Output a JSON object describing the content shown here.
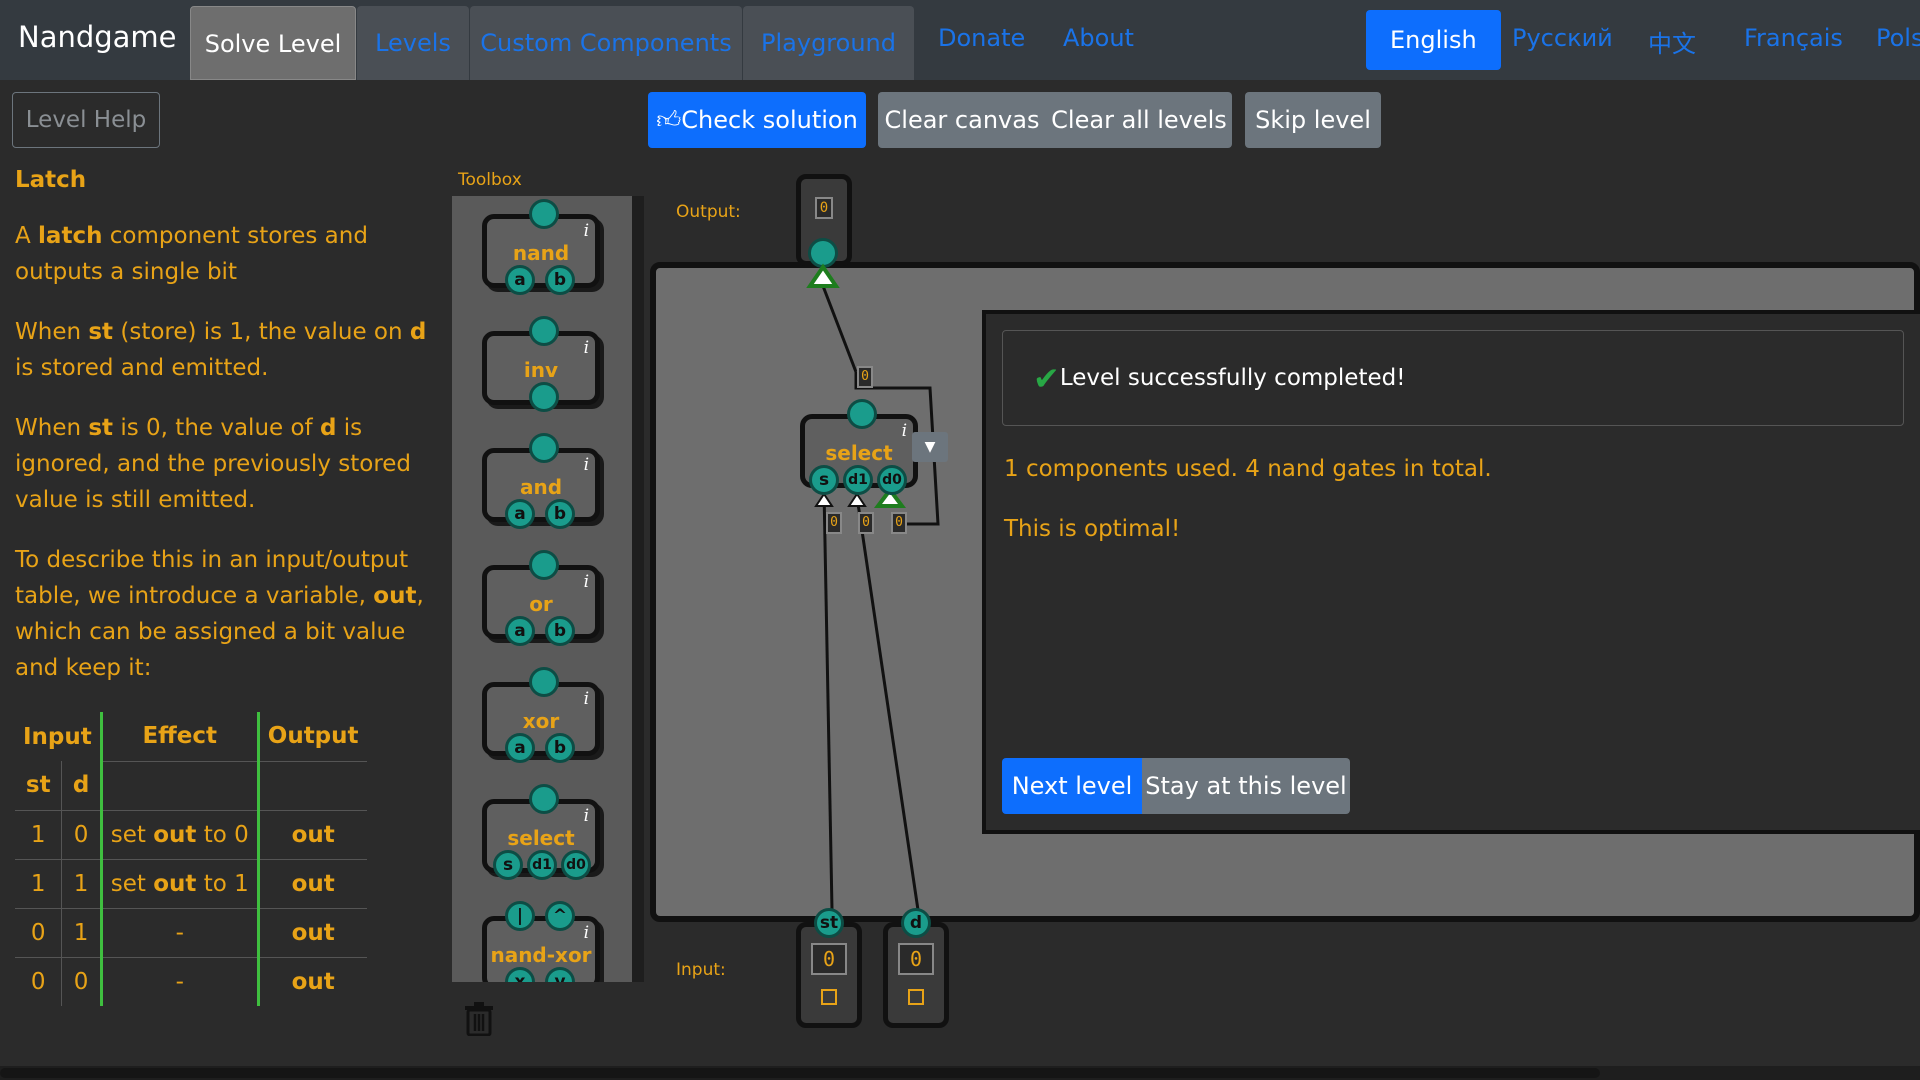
{
  "nav": {
    "brand": "Nandgame",
    "tabs": [
      "Solve Level",
      "Levels",
      "Custom Components",
      "Playground"
    ],
    "links": [
      "Donate",
      "About"
    ],
    "languages": [
      "English",
      "Русский",
      "中文",
      "Français",
      "Pols"
    ]
  },
  "help": {
    "button": "Level Help",
    "title": "Latch",
    "p1_a": "A ",
    "p1_b": "latch",
    "p1_c": " component stores and outputs a single bit",
    "p2_a": "When ",
    "p2_b": "st",
    "p2_c": " (store) is 1, the value on ",
    "p2_d": "d",
    "p2_e": " is stored and emitted.",
    "p3_a": "When ",
    "p3_b": "st",
    "p3_c": " is 0, the value of ",
    "p3_d": "d",
    "p3_e": " is ignored, and the previously stored value is still emitted.",
    "p4_a": "To describe this in an input/output table, we introduce a variable, ",
    "p4_b": "out",
    "p4_c": ", which can be assigned a bit value and keep it:",
    "table": {
      "headers": [
        "Input",
        "Effect",
        "Output"
      ],
      "sub": [
        "st",
        "d"
      ],
      "rows": [
        {
          "st": "1",
          "d": "0",
          "e1": "set ",
          "e2": "out",
          "e3": " to 0",
          "out": "out"
        },
        {
          "st": "1",
          "d": "1",
          "e1": "set ",
          "e2": "out",
          "e3": " to 1",
          "out": "out"
        },
        {
          "st": "0",
          "d": "1",
          "e1": "-",
          "e2": "",
          "e3": "",
          "out": "out"
        },
        {
          "st": "0",
          "d": "0",
          "e1": "-",
          "e2": "",
          "e3": "",
          "out": "out"
        }
      ]
    }
  },
  "toolbar": {
    "check": "Check solution",
    "clear_canvas": "Clear canvas",
    "clear_all": "Clear all levels",
    "skip": "Skip level"
  },
  "toolbox": {
    "label": "Toolbox",
    "info": "i",
    "components": [
      {
        "name": "nand",
        "inputs": [
          "a",
          "b"
        ]
      },
      {
        "name": "inv",
        "inputs": [
          ""
        ]
      },
      {
        "name": "and",
        "inputs": [
          "a",
          "b"
        ]
      },
      {
        "name": "or",
        "inputs": [
          "a",
          "b"
        ]
      },
      {
        "name": "xor",
        "inputs": [
          "a",
          "b"
        ]
      },
      {
        "name": "select",
        "inputs": [
          "s",
          "d1",
          "d0"
        ]
      },
      {
        "name": "nand-xor",
        "outputs": [
          "|",
          "^"
        ],
        "inputs": [
          "x",
          "y"
        ]
      }
    ]
  },
  "canvas": {
    "output_label": "Output:",
    "input_label": "Input:",
    "output_value": "0",
    "select": {
      "name": "select",
      "pins": [
        "s",
        "d1",
        "d0"
      ],
      "top_value": "0",
      "pin_values": [
        "0",
        "0",
        "0"
      ]
    },
    "inputs": [
      {
        "name": "st",
        "value": "0"
      },
      {
        "name": "d",
        "value": "0"
      }
    ]
  },
  "modal": {
    "success": "Level successfully completed!",
    "stats": "1 components used. 4 nand gates in total.",
    "optimal": "This is optimal!",
    "next": "Next level",
    "stay": "Stay at this level"
  },
  "colors": {
    "accent": "#e8a317",
    "primary": "#0d6efd",
    "pin": "#1a9c8c",
    "success": "#28a745"
  }
}
